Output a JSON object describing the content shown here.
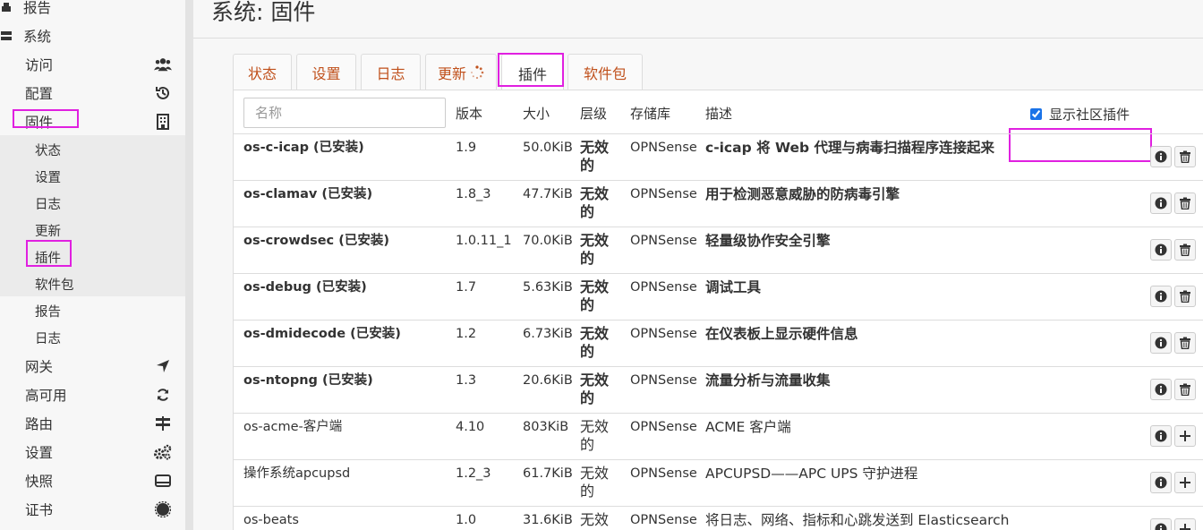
{
  "sidebar": {
    "top_items": [
      {
        "label": "报告",
        "icon": "report-icon"
      },
      {
        "label": "系统",
        "icon": "system-icon"
      }
    ],
    "system_items": [
      {
        "label": "访问",
        "icon": "users-icon"
      },
      {
        "label": "配置",
        "icon": "history-icon"
      },
      {
        "label": "固件",
        "icon": "firmware-icon"
      }
    ],
    "firmware_sub": [
      {
        "label": "状态"
      },
      {
        "label": "设置"
      },
      {
        "label": "日志"
      },
      {
        "label": "更新"
      },
      {
        "label": "插件"
      },
      {
        "label": "软件包"
      }
    ],
    "system_more": [
      {
        "label": "报告"
      },
      {
        "label": "日志"
      }
    ],
    "bottom_items": [
      {
        "label": "网关",
        "icon": "location-arrow-icon"
      },
      {
        "label": "高可用",
        "icon": "refresh-icon"
      },
      {
        "label": "路由",
        "icon": "signpost-icon"
      },
      {
        "label": "设置",
        "icon": "cogs-icon"
      },
      {
        "label": "快照",
        "icon": "hdd-icon"
      },
      {
        "label": "证书",
        "icon": "certificate-icon"
      }
    ]
  },
  "page": {
    "title": "系统: 固件"
  },
  "tabs": [
    {
      "label": "状态"
    },
    {
      "label": "设置"
    },
    {
      "label": "日志"
    },
    {
      "label": "更新"
    },
    {
      "label": "插件"
    },
    {
      "label": "软件包"
    }
  ],
  "table": {
    "search_placeholder": "名称",
    "headers": {
      "version": "版本",
      "size": "大小",
      "tier": "层级",
      "repo": "存储库",
      "desc": "描述"
    },
    "community_label": "显示社区插件",
    "community_checked": true,
    "rows": [
      {
        "name": "os-c-icap (已安装)",
        "version": "1.9",
        "size": "50.0KiB",
        "tier": "无效的",
        "repo": "OPNSense",
        "desc": "c-icap 将 Web 代理与病毒扫描程序连接起来",
        "installed": true
      },
      {
        "name": "os-clamav (已安装)",
        "version": "1.8_3",
        "size": "47.7KiB",
        "tier": "无效的",
        "repo": "OPNSense",
        "desc": "用于检测恶意威胁的防病毒引擎",
        "installed": true
      },
      {
        "name": "os-crowdsec (已安装)",
        "version": "1.0.11_1",
        "size": "70.0KiB",
        "tier": "无效的",
        "repo": "OPNSense",
        "desc": "轻量级协作安全引擎",
        "installed": true
      },
      {
        "name": "os-debug (已安装)",
        "version": "1.7",
        "size": "5.63KiB",
        "tier": "无效的",
        "repo": "OPNSense",
        "desc": "调试工具",
        "installed": true
      },
      {
        "name": "os-dmidecode (已安装)",
        "version": "1.2",
        "size": "6.73KiB",
        "tier": "无效的",
        "repo": "OPNSense",
        "desc": "在仪表板上显示硬件信息",
        "installed": true
      },
      {
        "name": "os-ntopng (已安装)",
        "version": "1.3",
        "size": "20.6KiB",
        "tier": "无效的",
        "repo": "OPNSense",
        "desc": "流量分析与流量收集",
        "installed": true
      },
      {
        "name": "os-acme-客户端",
        "version": "4.10",
        "size": "803KiB",
        "tier": "无效的",
        "repo": "OPNSense",
        "desc": "ACME 客户端",
        "installed": false
      },
      {
        "name": "操作系统apcupsd",
        "version": "1.2_3",
        "size": "61.7KiB",
        "tier": "无效的",
        "repo": "OPNSense",
        "desc": "APCUPSD——APC UPS 守护进程",
        "installed": false
      },
      {
        "name": "os-beats",
        "version": "1.0",
        "size": "31.6KiB",
        "tier": "无效的",
        "repo": "OPNSense",
        "desc": "将日志、网络、指标和心跳发送到 Elasticsearch",
        "installed": false
      }
    ]
  },
  "colors": {
    "accent": "#c0501b",
    "highlight": "#e020e0"
  }
}
